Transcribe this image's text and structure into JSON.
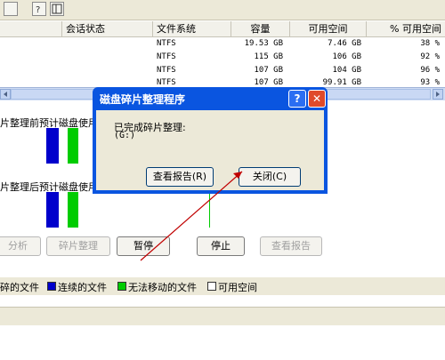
{
  "columns": {
    "session_status": "会话状态",
    "file_system": "文件系统",
    "capacity": "容量",
    "free_space": "可用空间",
    "pct_free": "% 可用空间"
  },
  "volumes": [
    {
      "fs": "NTFS",
      "capacity": "19.53 GB",
      "free": "7.46 GB",
      "pct": "38 %"
    },
    {
      "fs": "NTFS",
      "capacity": "115 GB",
      "free": "106 GB",
      "pct": "92 %"
    },
    {
      "fs": "NTFS",
      "capacity": "107 GB",
      "free": "104 GB",
      "pct": "96 %"
    },
    {
      "fs": "NTFS",
      "capacity": "107 GB",
      "free": "99.91 GB",
      "pct": "93 %"
    }
  ],
  "panes": {
    "before_label": "片整理前预计磁盘使用",
    "after_label": "片整理后预计磁盘使用"
  },
  "actions": {
    "analyze": "分析",
    "defragment": "碎片整理",
    "pause": "暂停",
    "stop": "停止",
    "view_report": "查看报告"
  },
  "legend": {
    "fragmented": "碎的文件",
    "contiguous": "连续的文件",
    "unmovable": "无法移动的文件",
    "free": "可用空间"
  },
  "colors": {
    "fragmented": "#cc0000",
    "contiguous": "#0000cc",
    "unmovable": "#00cc00",
    "free": "#ffffff"
  },
  "dialog": {
    "title": "磁盘碎片整理程序",
    "message": "已完成碎片整理:",
    "drive": "(G:)",
    "view_report": "查看报告(R)",
    "close": "关闭(C)"
  }
}
